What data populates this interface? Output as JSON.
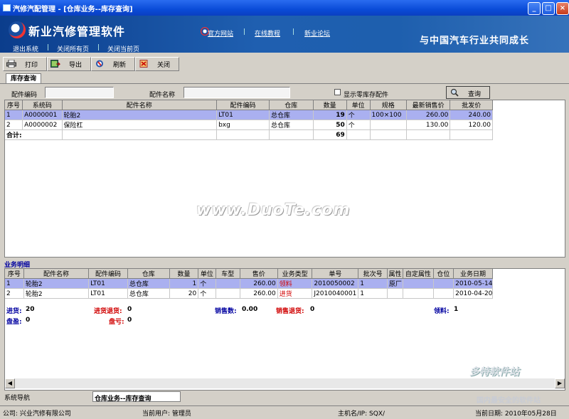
{
  "window": {
    "title": "汽修汽配管理 - [仓库业务--库存查询]",
    "min": "_",
    "max": "□",
    "close": "×"
  },
  "banner": {
    "app_name": "新业汽修管理软件",
    "top_links": [
      "官方网站",
      "在线教程",
      "新业论坛"
    ],
    "bottom_links": [
      "退出系统",
      "关闭所有页",
      "关闭当前页"
    ],
    "slogan": "与中国汽车行业共同成长"
  },
  "toolbar": {
    "print": "打印",
    "export": "导出",
    "refresh": "刷新",
    "close": "关闭"
  },
  "tab": {
    "label": "库存查询"
  },
  "filter": {
    "code_label": "配件编码",
    "code_value": "",
    "name_label": "配件名称",
    "name_value": "",
    "zero_stock_label": "显示零库存配件",
    "zero_stock_checked": false,
    "query_label": "查询"
  },
  "stock_table": {
    "headers": [
      "序号",
      "系统码",
      "配件名称",
      "配件编码",
      "仓库",
      "数量",
      "单位",
      "规格",
      "最新销售价",
      "批发价"
    ],
    "rows": [
      [
        "1",
        "A0000001",
        "轮胎2",
        "LT01",
        "总仓库",
        "19",
        "个",
        "100×100",
        "260.00",
        "240.00"
      ],
      [
        "2",
        "A0000002",
        "保险杠",
        "bxg",
        "总仓库",
        "50",
        "个",
        "",
        "130.00",
        "120.00"
      ]
    ],
    "total_label": "合计:",
    "total_qty": "69"
  },
  "watermark": "www.DuoTe.com",
  "detail": {
    "section_label": "业务明细",
    "headers": [
      "序号",
      "配件名称",
      "配件编码",
      "仓库",
      "数量",
      "单位",
      "车型",
      "售价",
      "业务类型",
      "单号",
      "批次号",
      "属性",
      "自定属性",
      "仓位",
      "业务日期"
    ],
    "rows": [
      [
        "1",
        "轮胎2",
        "LT01",
        "总仓库",
        "1",
        "个",
        "",
        "260.00",
        "领料",
        "2010050002",
        "1",
        "原厂",
        "",
        "",
        "2010-05-14"
      ],
      [
        "2",
        "轮胎2",
        "LT01",
        "总仓库",
        "20",
        "个",
        "",
        "260.00",
        "进货",
        "J2010040001",
        "1",
        "",
        "",
        "",
        "2010-04-20"
      ]
    ],
    "summary": {
      "purchase_label": "进货:",
      "purchase_value": "20",
      "purchase_return_label": "进货退货:",
      "purchase_return_value": "0",
      "sales_label": "销售数:",
      "sales_value": "0.00",
      "sales_return_label": "销售退货:",
      "sales_return_value": "0",
      "pick_label": "领料:",
      "pick_value": "1",
      "surplus_label": "盘盈:",
      "surplus_value": "0",
      "loss_label": "盘亏:",
      "loss_value": "0"
    }
  },
  "nav": {
    "label": "系统导航",
    "current_page": "仓库业务--库存查询"
  },
  "status": {
    "company": "公司:   兴业汽修有限公司",
    "user": "当前用户:  管理员",
    "host": "主机名/IP:  SQX/",
    "date": "当前日期:  2010年05月28日"
  },
  "corner_watermark": {
    "main": "多特软件站",
    "sub": "国内最安全的软件站"
  },
  "colors": {
    "title_bar": "#0a4bd8",
    "banner": "#1f5fb0",
    "selected_row": "#aab0f0",
    "red_text": "#d00000"
  }
}
